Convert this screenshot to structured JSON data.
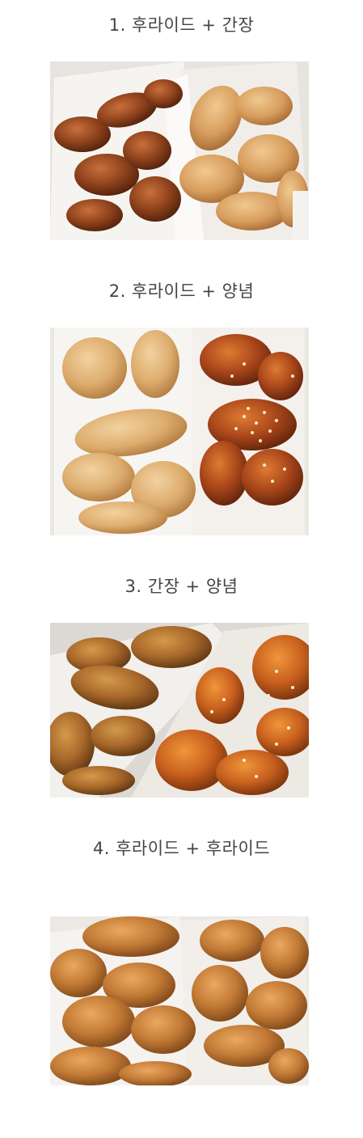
{
  "sections": [
    {
      "caption": "1. 후라이드 + 간장",
      "image": "fried-and-soy-chicken-photo"
    },
    {
      "caption": "2. 후라이드 + 양념",
      "image": "fried-and-seasoned-chicken-photo"
    },
    {
      "caption": "3. 간장 + 양념",
      "image": "soy-and-seasoned-chicken-photo"
    },
    {
      "caption": "4. 후라이드 + 후라이드",
      "image": "fried-and-fried-chicken-photo"
    }
  ],
  "colors": {
    "text": "#444444",
    "box": "#f3f1ee",
    "fried": "#d9a466",
    "soy": "#8a3f1a",
    "seasoned": "#b9521c",
    "sesame": "#f4e7c8"
  }
}
